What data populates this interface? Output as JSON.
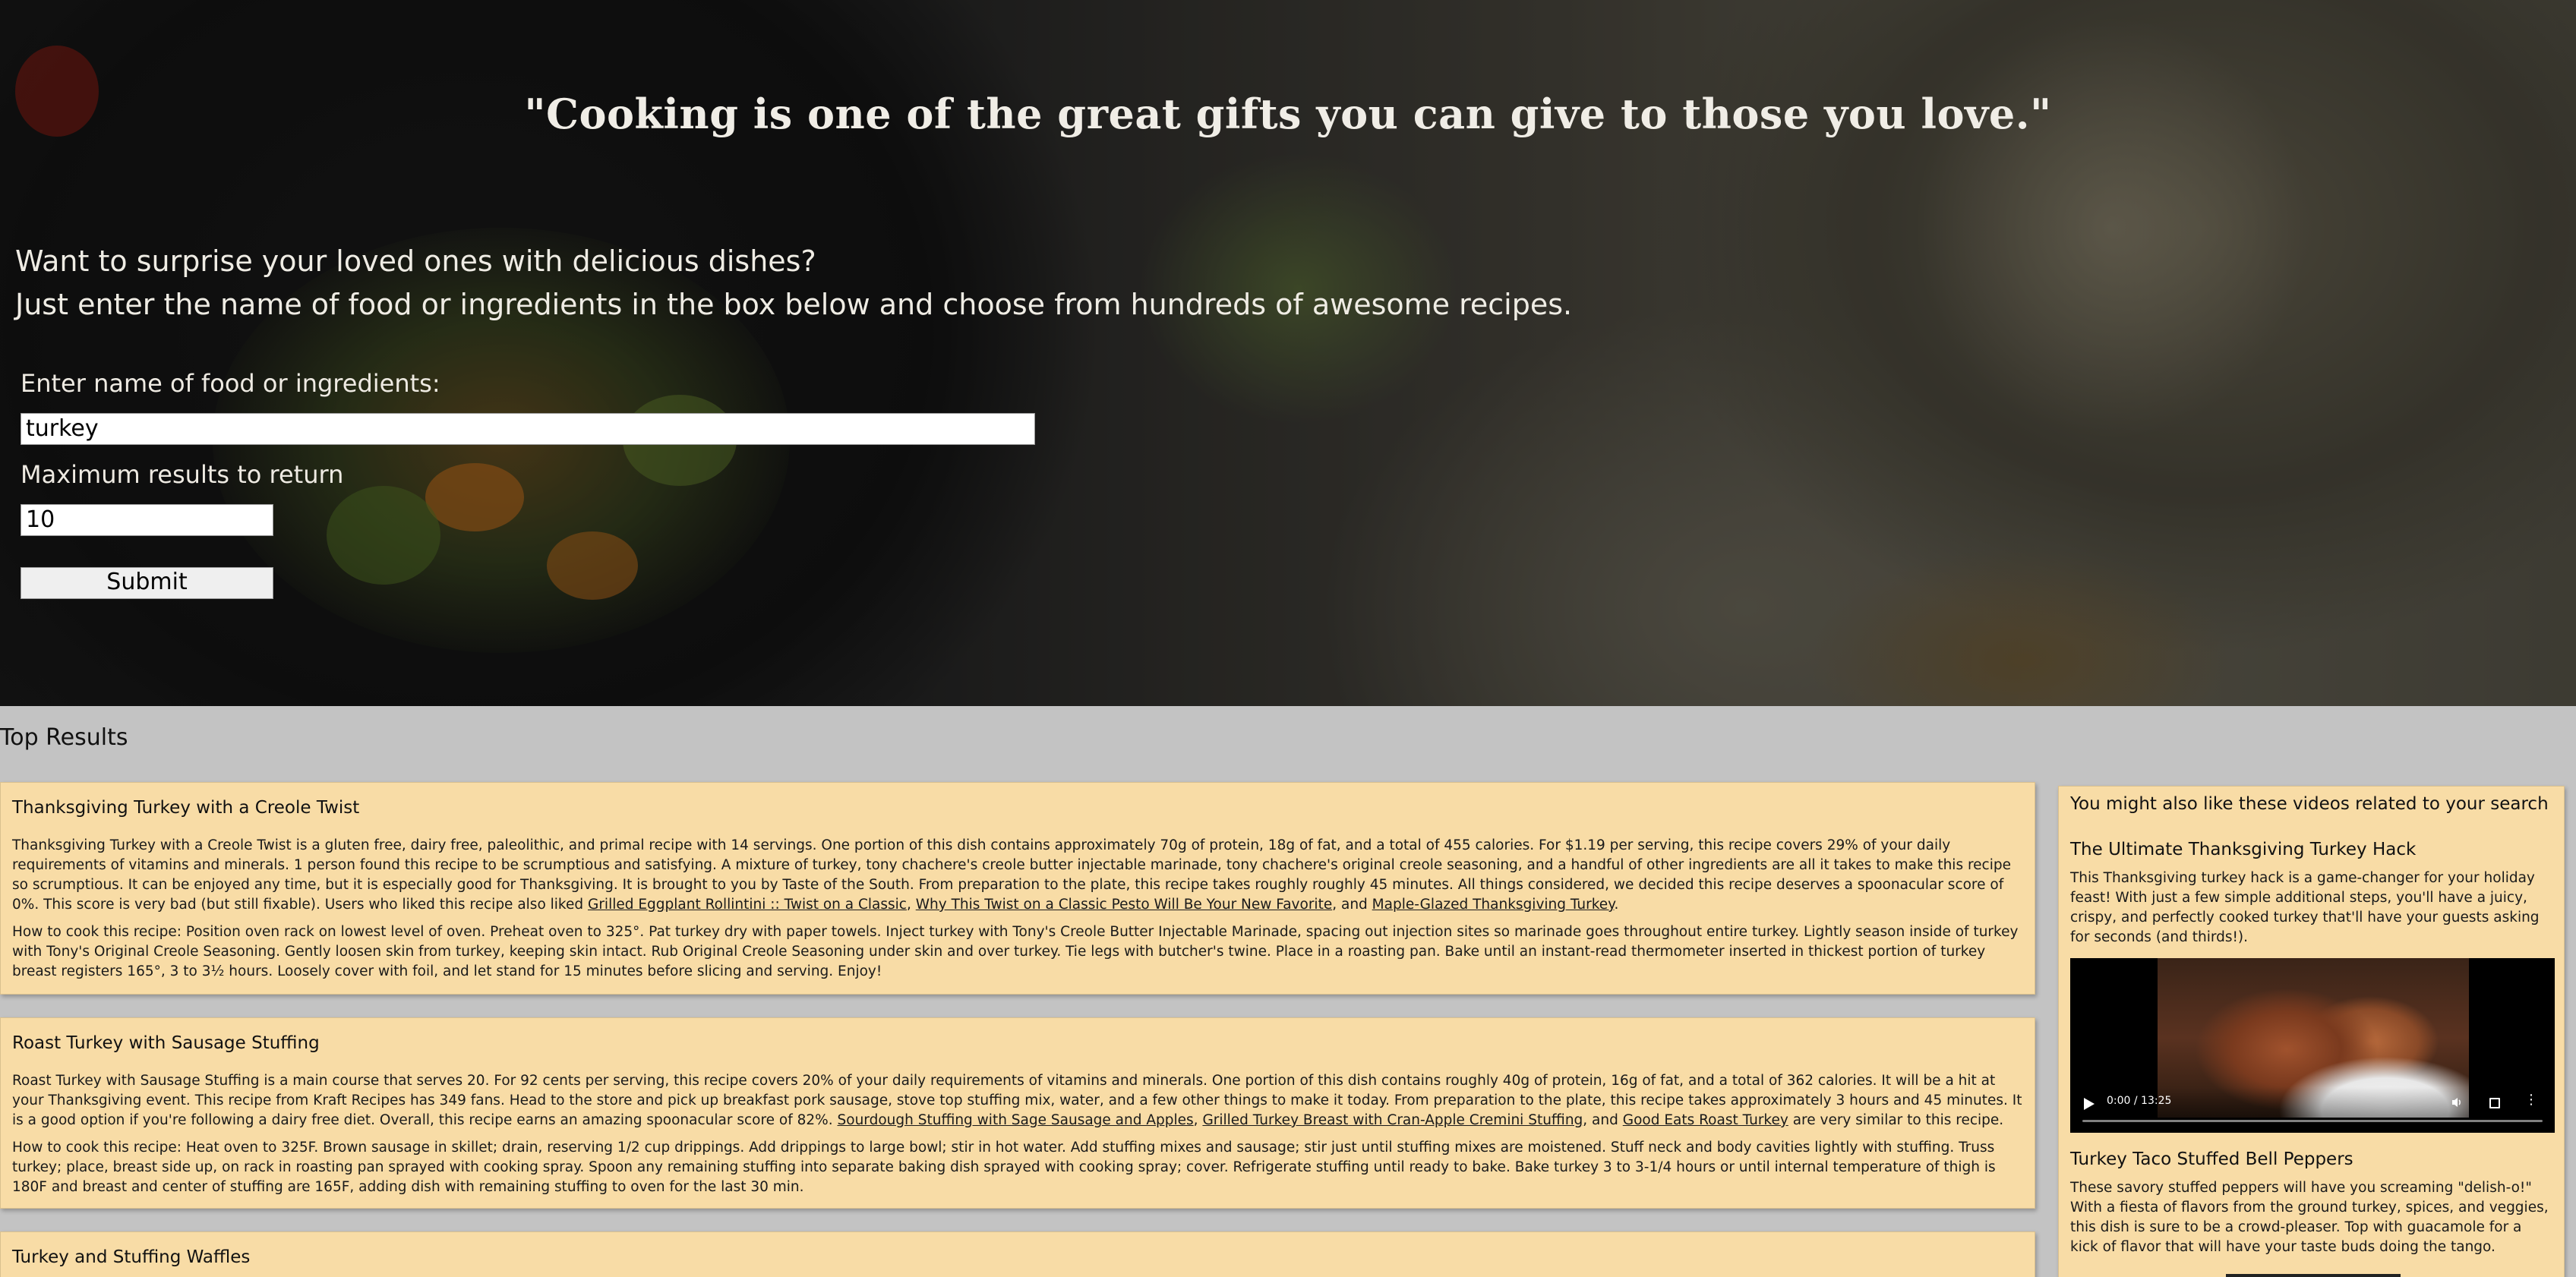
{
  "hero": {
    "quote": "\"Cooking is one of the great gifts you can give to those you love.\"",
    "intro_line1": "Want to surprise your loved ones with delicious dishes?",
    "intro_line2": "Just enter the name of food or ingredients in the box below and choose from hundreds of awesome recipes."
  },
  "form": {
    "food_label": "Enter name of food or ingredients:",
    "food_value": "turkey",
    "max_label": "Maximum results to return",
    "max_value": "10",
    "submit_label": "Submit"
  },
  "results": {
    "heading": "Top Results",
    "recipes": [
      {
        "title": "Thanksgiving Turkey with a Creole Twist",
        "summary_text": "Thanksgiving Turkey with a Creole Twist is a gluten free, dairy free, paleolithic, and primal recipe with 14 servings. One portion of this dish contains approximately 70g of protein, 18g of fat, and a total of 455 calories. For $1.19 per serving, this recipe covers 29% of your daily requirements of vitamins and minerals. 1 person found this recipe to be scrumptious and satisfying. A mixture of turkey, tony chachere's creole butter injectable marinade, tony chachere's original creole seasoning, and a handful of other ingredients are all it takes to make this recipe so scrumptious. It can be enjoyed any time, but it is especially good for Thanksgiving. It is brought to you by Taste of the South. From preparation to the plate, this recipe takes roughly roughly 45 minutes. All things considered, we decided this recipe deserves a spoonacular score of 0%. This score is very bad (but still fixable). Users who liked this recipe also liked ",
        "link1": "Grilled Eggplant Rollintini :: Twist on a Classic",
        "sep1": ", ",
        "link2": "Why This Twist on a Classic Pesto Will Be Your New Favorite",
        "sep2": ", and ",
        "link3": "Maple-Glazed Thanksgiving Turkey",
        "tail": ".",
        "instructions": "How to cook this recipe: Position oven rack on lowest level of oven. Preheat oven to 325°. Pat turkey dry with paper towels. Inject turkey with Tony's Creole Butter Injectable Marinade, spacing out injection sites so marinade goes throughout entire turkey. Lightly season inside of turkey with Tony's Original Creole Seasoning. Gently loosen skin from turkey, keeping skin intact. Rub Original Creole Seasoning under skin and over turkey. Tie legs with butcher's twine. Place in a roasting pan. Bake until an instant-read thermometer inserted in thickest portion of turkey breast registers 165°, 3 to 3½ hours. Loosely cover with foil, and let stand for 15 minutes before slicing and serving. Enjoy!"
      },
      {
        "title": "Roast Turkey with Sausage Stuffing",
        "summary_text": "Roast Turkey with Sausage Stuffing is a main course that serves 20. For 92 cents per serving, this recipe covers 20% of your daily requirements of vitamins and minerals. One portion of this dish contains roughly 40g of protein, 16g of fat, and a total of 362 calories. It will be a hit at your Thanksgiving event. This recipe from Kraft Recipes has 349 fans. Head to the store and pick up breakfast pork sausage, stove top stuffing mix, water, and a few other things to make it today. From preparation to the plate, this recipe takes approximately 3 hours and 45 minutes. It is a good option if you're following a dairy free diet. Overall, this recipe earns an amazing spoonacular score of 82%. ",
        "link1": "Sourdough Stuffing with Sage Sausage and Apples",
        "sep1": ", ",
        "link2": "Grilled Turkey Breast with Cran-Apple Cremini Stuffing",
        "sep2": ", and ",
        "link3": "Good Eats Roast Turkey",
        "tail": " are very similar to this recipe.",
        "instructions": "How to cook this recipe: Heat oven to 325F. Brown sausage in skillet; drain, reserving 1/2 cup drippings. Add drippings to large bowl; stir in hot water. Add stuffing mixes and sausage; stir just until stuffing mixes are moistened. Stuff neck and body cavities lightly with stuffing. Truss turkey; place, breast side up, on rack in roasting pan sprayed with cooking spray. Spoon any remaining stuffing into separate baking dish sprayed with cooking spray; cover. Refrigerate stuffing until ready to bake. Bake turkey 3 to 3-1/4 hours or until internal temperature of thigh is 180F and breast and center of stuffing are 165F, adding dish with remaining stuffing to oven for the last 30 min."
      },
      {
        "title": "Turkey and Stuffing Waffles"
      }
    ]
  },
  "sidebar": {
    "title": "You might also like these videos related to your search",
    "videos": [
      {
        "title": "The Ultimate Thanksgiving Turkey Hack",
        "description": "This Thanksgiving turkey hack is a game-changer for your holiday feast! With just a few simple additional steps, you'll have a juicy, crispy, and perfectly cooked turkey that'll have your guests asking for seconds (and thirds!).",
        "time": "0:00 / 13:25"
      },
      {
        "title": "Turkey Taco Stuffed Bell Peppers",
        "description": "These savory stuffed peppers will have you screaming \"delish-o!\" With a fiesta of flavors from the ground turkey, spices, and veggies, this dish is sure to be a crowd-pleaser. Top with guacamole for a kick of flavor that will have your taste buds doing the tango."
      }
    ]
  },
  "colors": {
    "card_bg": "#f8dca6",
    "page_bg": "#c3c3c3",
    "hero_text": "#f0ede6"
  },
  "icons": [
    "play-icon",
    "volume-icon",
    "fullscreen-icon",
    "more-options-icon"
  ]
}
